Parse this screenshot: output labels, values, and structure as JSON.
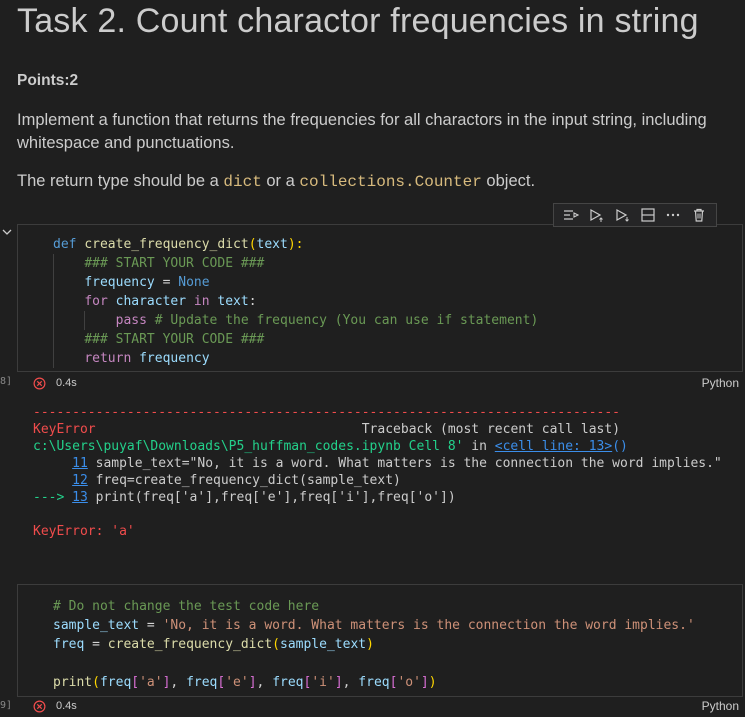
{
  "markdown": {
    "title": "Task 2. Count charactor frequencies in string",
    "points": "Points:2",
    "paragraph1": "Implement a function that returns the frequencies for all charactors in the input string, including whitespace and punctuations.",
    "p2_prefix": "The return type should be a ",
    "p2_code1": "dict",
    "p2_middle": " or a ",
    "p2_code2": "collections.Counter",
    "p2_suffix": " object."
  },
  "toolbar": {
    "icons": [
      "run-by-line-icon",
      "execute-above-icon",
      "execute-below-icon",
      "split-cell-icon",
      "more-icon",
      "delete-icon"
    ]
  },
  "cell1": {
    "exec_marker": "8]",
    "status_time": "0.4s",
    "language": "Python",
    "code": {
      "l1_def": "def",
      "l1_fn": "create_frequency_dict",
      "l1_open": "(",
      "l1_param": "text",
      "l1_close": "):",
      "l2": "### START YOUR CODE ###",
      "l3_var": "frequency",
      "l3_eq": " = ",
      "l3_val": "None",
      "l4_for": "for",
      "l4_var": "character",
      "l4_in": "in",
      "l4_iter": "text",
      "l4_colon": ":",
      "l5_pass": "pass",
      "l5_comment": "# Update the frequency (You can use if statement)",
      "l6": "### START YOUR CODE ###",
      "l7_ret": "return",
      "l7_var": "frequency"
    }
  },
  "output": {
    "dashes": "---------------------------------------------------------------------------",
    "error_name": "KeyError",
    "traceback_label": "Traceback (most recent call last)",
    "path": "c:\\Users\\puyaf\\Downloads\\P5_huffman_codes.ipynb Cell 8'",
    "in_word": " in ",
    "cell_link": "<cell line: 13>",
    "cell_paren": "()",
    "line11_num": "11",
    "line11_code": " sample_text=\"No, it is a word. What matters is the connection the word implies.\"",
    "line12_num": "12",
    "line12_code": " freq=create_frequency_dict(sample_text)",
    "arrow": "---> ",
    "line13_num": "13",
    "line13_code": " print(freq['a'],freq['e'],freq['i'],freq['o'])",
    "final_error": "KeyError",
    "final_msg": ": 'a'"
  },
  "cell2": {
    "exec_marker": "9]",
    "status_time": "0.4s",
    "language": "Python",
    "code": {
      "l1": "# Do not change the test code here",
      "l2_var": "sample_text",
      "l2_eq": " = ",
      "l2_str": "'No, it is a word. What matters is the connection the word implies.'",
      "l3_var": "freq",
      "l3_eq": " = ",
      "l3_fn": "create_frequency_dict",
      "l3_open": "(",
      "l3_arg": "sample_text",
      "l3_close": ")",
      "l5_fn": "print",
      "l5_open": "(",
      "l5_a1": "freq",
      "l5_k1": "'a'",
      "l5_a2": "freq",
      "l5_k2": "'e'",
      "l5_a3": "freq",
      "l5_k3": "'i'",
      "l5_a4": "freq",
      "l5_k4": "'o'",
      "l5_close": ")"
    }
  },
  "colors": {
    "background": "#1f1f1f",
    "error": "#f14c4c",
    "keyword": "#569cd6",
    "comment": "#6a9955",
    "string": "#ce9178"
  }
}
